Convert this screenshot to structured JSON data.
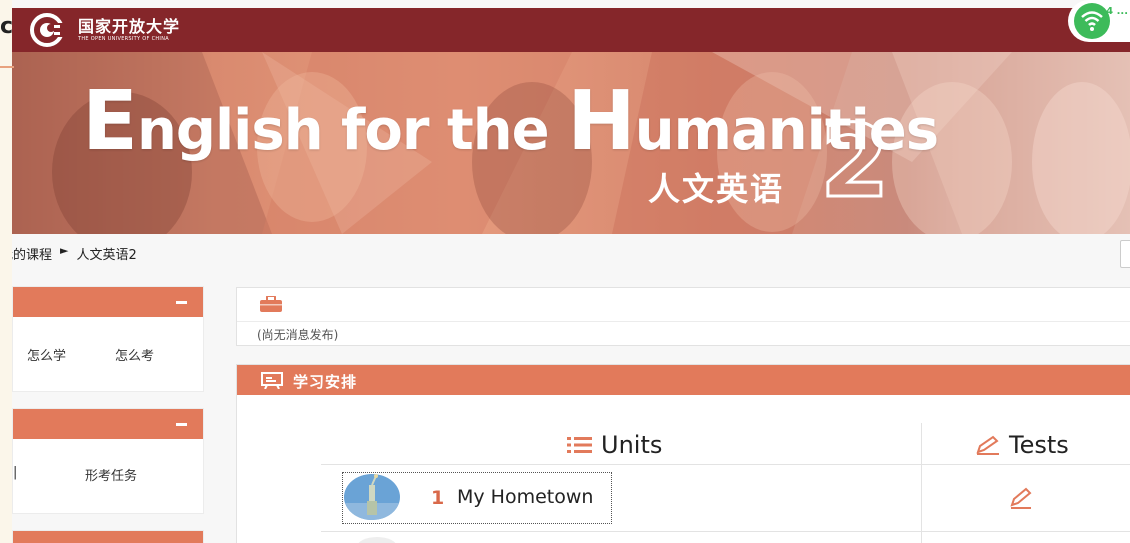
{
  "app": {
    "logo_cn": "国家开放大学",
    "logo_en": "THE OPEN UNIVERSITY OF CHINA",
    "edge_glyph": "c"
  },
  "banner": {
    "title_E": "E",
    "title_part1": "nglish for the ",
    "title_H": "H",
    "title_part2": "umanities",
    "subtitle_cn": "人文英语",
    "number": "2"
  },
  "status_bar": {
    "icon": "wifi-icon",
    "side_text": "4 ..."
  },
  "breadcrumb": {
    "items": [
      "我的课程",
      "人文英语2"
    ],
    "separator": "►",
    "visible_first": "我的课程"
  },
  "sidebar": {
    "panels": [
      {
        "items": [
          "怎么学",
          "怎么考"
        ]
      },
      {
        "items": [
          "形考任务"
        ]
      }
    ]
  },
  "notice": {
    "icon": "notice-icon",
    "text": "(尚无消息发布)"
  },
  "schedule": {
    "title": "学习安排",
    "icon": "schedule-icon",
    "columns": {
      "units": "Units",
      "tests": "Tests"
    },
    "rows": [
      {
        "number": "1",
        "name": "My Hometown",
        "thumb": "statue-of-liberty-thumbnail",
        "test_icon": "pencil-icon"
      }
    ]
  },
  "colors": {
    "header_bg": "#85262a",
    "accent": "#e27a5b",
    "unit_number": "#d9694a"
  }
}
